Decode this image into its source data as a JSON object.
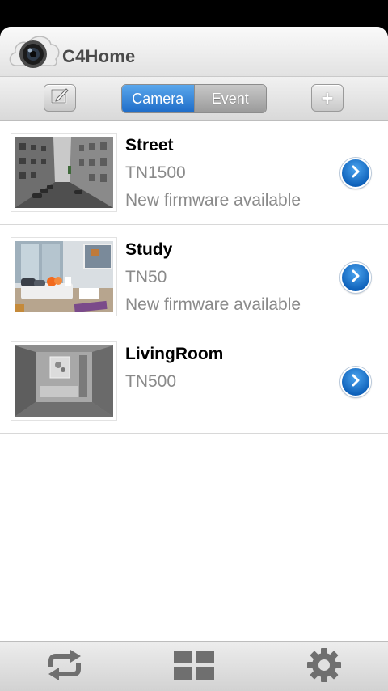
{
  "app": {
    "title": "C4Home"
  },
  "toolbar": {
    "tabs": [
      {
        "label": "Camera",
        "active": true
      },
      {
        "label": "Event",
        "active": false
      }
    ],
    "edit_icon": "edit-icon",
    "add_label": "+"
  },
  "cameras": [
    {
      "name": "Street",
      "model": "TN1500",
      "status": "New firmware available",
      "thumbnail": "street-scene"
    },
    {
      "name": "Study",
      "model": "TN50",
      "status": "New firmware available",
      "thumbnail": "study-room"
    },
    {
      "name": "LivingRoom",
      "model": "TN500",
      "status": "",
      "thumbnail": "living-room-grayscale"
    }
  ],
  "bottom_nav": [
    "refresh-icon",
    "grid-view-icon",
    "settings-gear-icon"
  ],
  "colors": {
    "accent": "#1e6cc8",
    "detail_button": "#0c5fb8",
    "secondary_text": "#8a8a8a"
  }
}
